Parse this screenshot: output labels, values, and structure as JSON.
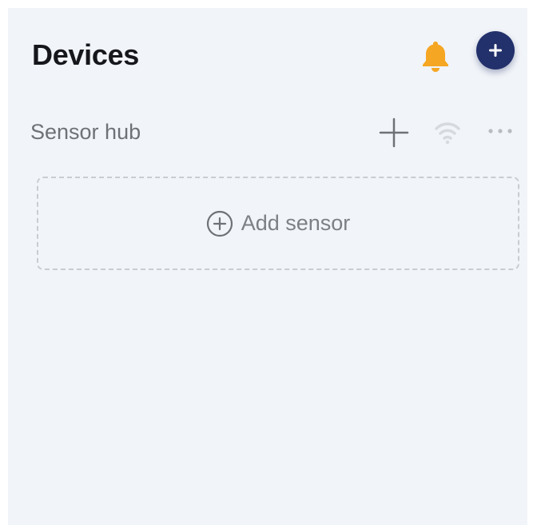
{
  "header": {
    "title": "Devices",
    "bell_icon": "bell-icon",
    "add_icon": "plus-icon"
  },
  "group": {
    "title": "Sensor hub",
    "actions": [
      "plus-icon",
      "wifi-icon",
      "more-horizontal-icon"
    ]
  },
  "add_sensor": {
    "label": "Add sensor",
    "icon": "plus-circle-icon"
  },
  "colors": {
    "background": "#f1f4f8",
    "accent": "#22306b",
    "bell": "#f5a623",
    "muted_text": "#6e7278"
  }
}
